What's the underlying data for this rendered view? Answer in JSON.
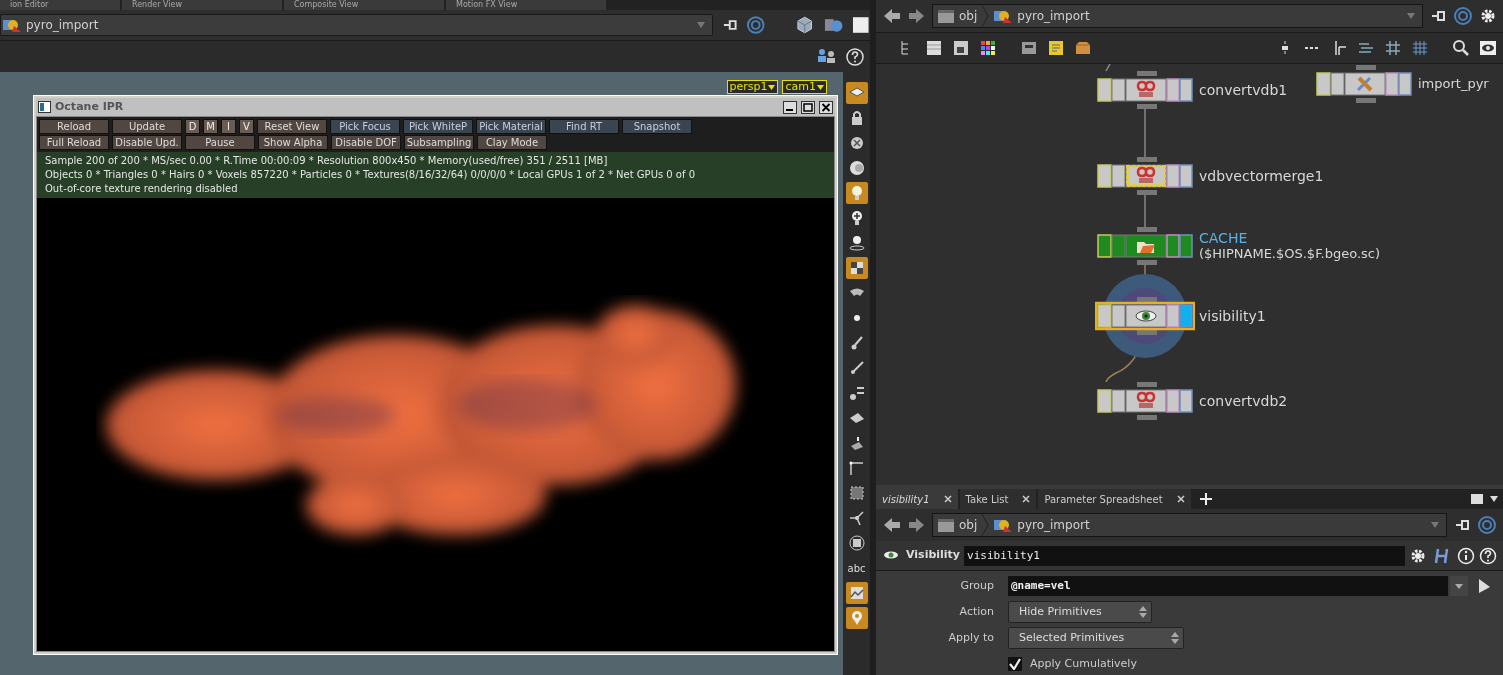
{
  "left_pane": {
    "tabs": [
      {
        "label": "ion Editor",
        "selected": false
      },
      {
        "label": "Render View",
        "selected": false
      },
      {
        "label": "Composite View",
        "selected": false
      },
      {
        "label": "Motion FX View",
        "selected": false
      }
    ],
    "path": "pyro_import",
    "camera_menus": [
      "persp1",
      "cam1"
    ],
    "viewport_tools": [
      {
        "kind": "icon",
        "active": true
      },
      {
        "kind": "icon",
        "active": false
      },
      {
        "kind": "icon",
        "active": false
      },
      {
        "kind": "icon",
        "active": false
      },
      {
        "kind": "icon",
        "active": true
      },
      {
        "kind": "icon",
        "active": false
      },
      {
        "kind": "icon",
        "active": false
      },
      {
        "kind": "icon",
        "active": true
      },
      {
        "kind": "icon",
        "active": false
      },
      {
        "kind": "icon",
        "active": false
      },
      {
        "kind": "icon",
        "active": false
      },
      {
        "kind": "icon",
        "active": false
      },
      {
        "kind": "icon",
        "active": false
      },
      {
        "kind": "icon",
        "active": false
      },
      {
        "kind": "icon",
        "active": false
      },
      {
        "kind": "icon",
        "active": false
      },
      {
        "kind": "icon",
        "active": false
      },
      {
        "kind": "icon",
        "active": false
      },
      {
        "kind": "icon",
        "active": false
      },
      {
        "kind": "text",
        "label": "abc",
        "active": false
      },
      {
        "kind": "icon",
        "active": true
      },
      {
        "kind": "icon",
        "active": true
      }
    ]
  },
  "octane_window": {
    "title": "Octane IPR",
    "button_rows": [
      [
        {
          "label": "Reload",
          "kind": "action"
        },
        {
          "label": "Update",
          "kind": "action"
        },
        {
          "label": "D",
          "kind": "toggle"
        },
        {
          "label": "M",
          "kind": "toggle"
        },
        {
          "label": "I",
          "kind": "toggle"
        },
        {
          "label": "V",
          "kind": "toggle"
        },
        {
          "label": "Reset View",
          "kind": "action"
        },
        {
          "label": "Pick Focus",
          "kind": "pick"
        },
        {
          "label": "Pick WhiteP",
          "kind": "pick"
        },
        {
          "label": "Pick Material",
          "kind": "pick"
        },
        {
          "label": "Find RT",
          "kind": "pick"
        },
        {
          "label": "Snapshot",
          "kind": "pick"
        }
      ],
      [
        {
          "label": "Full Reload",
          "kind": "action"
        },
        {
          "label": "Disable Upd.",
          "kind": "action"
        },
        {
          "label": "Pause",
          "kind": "wide"
        },
        {
          "label": "Show Alpha",
          "kind": "action"
        },
        {
          "label": "Disable DOF",
          "kind": "action"
        },
        {
          "label": "Subsampling",
          "kind": "action"
        },
        {
          "label": "Clay Mode",
          "kind": "action"
        }
      ]
    ],
    "status_lines": [
      "Sample 200 of 200 * MS/sec 0.00 * R.Time 00:00:09 * Resolution 800x450 * Memory(used/free) 351 / 2511 [MB]",
      "Objects 0 * Triangles 0 * Hairs 0 * Voxels 857220 * Particles 0 * Textures(8/16/32/64) 0/0/0/0 * Local GPUs 1 of 2 * Net GPUs 0 of 0",
      "Out-of-core texture rendering disabled"
    ]
  },
  "network_pane": {
    "path": [
      "obj",
      "pyro_import"
    ],
    "nodes": [
      {
        "kind": "vdb",
        "label": "convertvdb1",
        "selected": false,
        "bypassed": false,
        "display": false
      },
      {
        "kind": "geometry",
        "label": "import_pyr",
        "selected": false,
        "bypassed": false,
        "display": false
      },
      {
        "kind": "vdb",
        "label": "vdbvectormerge1",
        "selected": false,
        "bypassed": true,
        "display": false
      },
      {
        "kind": "cache",
        "label": "CACHE",
        "comment": "($HIPNAME.$OS.$F.bgeo.sc)",
        "selected": false,
        "bypassed": false,
        "display": false
      },
      {
        "kind": "visibility",
        "label": "visibility1",
        "selected": true,
        "bypassed": false,
        "display": true
      },
      {
        "kind": "vdb",
        "label": "convertvdb2",
        "selected": false,
        "bypassed": false,
        "display": false
      }
    ]
  },
  "parameter_pane": {
    "tabs": [
      {
        "label": "visibility1",
        "selected": true
      },
      {
        "label": "Take List",
        "selected": false
      },
      {
        "label": "Parameter Spreadsheet",
        "selected": false
      }
    ],
    "path": [
      "obj",
      "pyro_import"
    ],
    "node_type": "Visibility",
    "node_name": "visibility1",
    "fields": [
      {
        "kind": "text",
        "label": "Group",
        "value": "@name=vel"
      },
      {
        "kind": "menu",
        "label": "Action",
        "value": "Hide Primitives"
      },
      {
        "kind": "menu",
        "label": "Apply to",
        "value": "Selected Primitives"
      },
      {
        "kind": "checkbox",
        "label": "Apply Cumulatively",
        "checked": true
      }
    ]
  }
}
